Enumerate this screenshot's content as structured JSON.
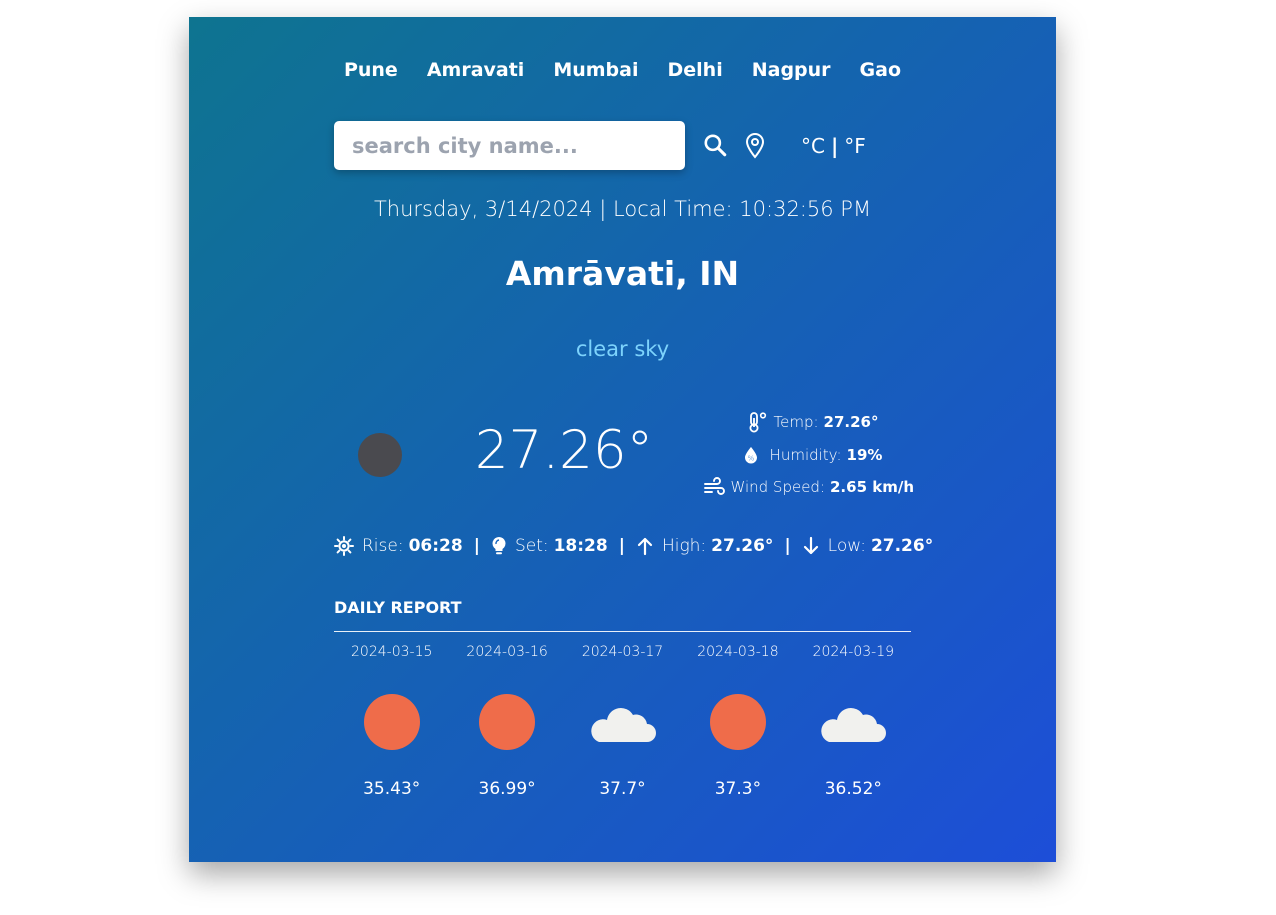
{
  "theme": {
    "gradient_start": "#0e7490",
    "gradient_end": "#1d4ed8",
    "description_color": "#7dd3fc",
    "sun_color": "#ef6c4a",
    "moon_color": "#4a4a4f"
  },
  "nav": {
    "cities": [
      "Pune",
      "Amravati",
      "Mumbai",
      "Delhi",
      "Nagpur",
      "Gao"
    ]
  },
  "search": {
    "placeholder": "search city name...",
    "value": ""
  },
  "units": {
    "celsius": "°C",
    "separator": "|",
    "fahrenheit": "°F"
  },
  "datetime": "Thursday, 3/14/2024 | Local Time: 10:32:56 PM",
  "location": "Amrāvati, IN",
  "description": "clear sky",
  "current": {
    "temp": "27.26°",
    "icon": "moon-icon"
  },
  "details": {
    "temp_label": "Temp:",
    "temp_value": "27.26°",
    "humidity_label": "Humidity:",
    "humidity_value": "19%",
    "wind_label": "Wind Speed:",
    "wind_value": "2.65 km/h"
  },
  "sun": {
    "rise_label": "Rise:",
    "rise_value": "06:28",
    "set_label": "Set:",
    "set_value": "18:28",
    "high_label": "High:",
    "high_value": "27.26°",
    "low_label": "Low:",
    "low_value": "27.26°",
    "separator": "|"
  },
  "daily": {
    "title": "DAILY REPORT",
    "items": [
      {
        "date": "2024-03-15",
        "icon": "sun-icon",
        "temp": "35.43°"
      },
      {
        "date": "2024-03-16",
        "icon": "sun-icon",
        "temp": "36.99°"
      },
      {
        "date": "2024-03-17",
        "icon": "cloud-icon",
        "temp": "37.7°"
      },
      {
        "date": "2024-03-18",
        "icon": "sun-icon",
        "temp": "37.3°"
      },
      {
        "date": "2024-03-19",
        "icon": "cloud-icon",
        "temp": "36.52°"
      }
    ]
  }
}
